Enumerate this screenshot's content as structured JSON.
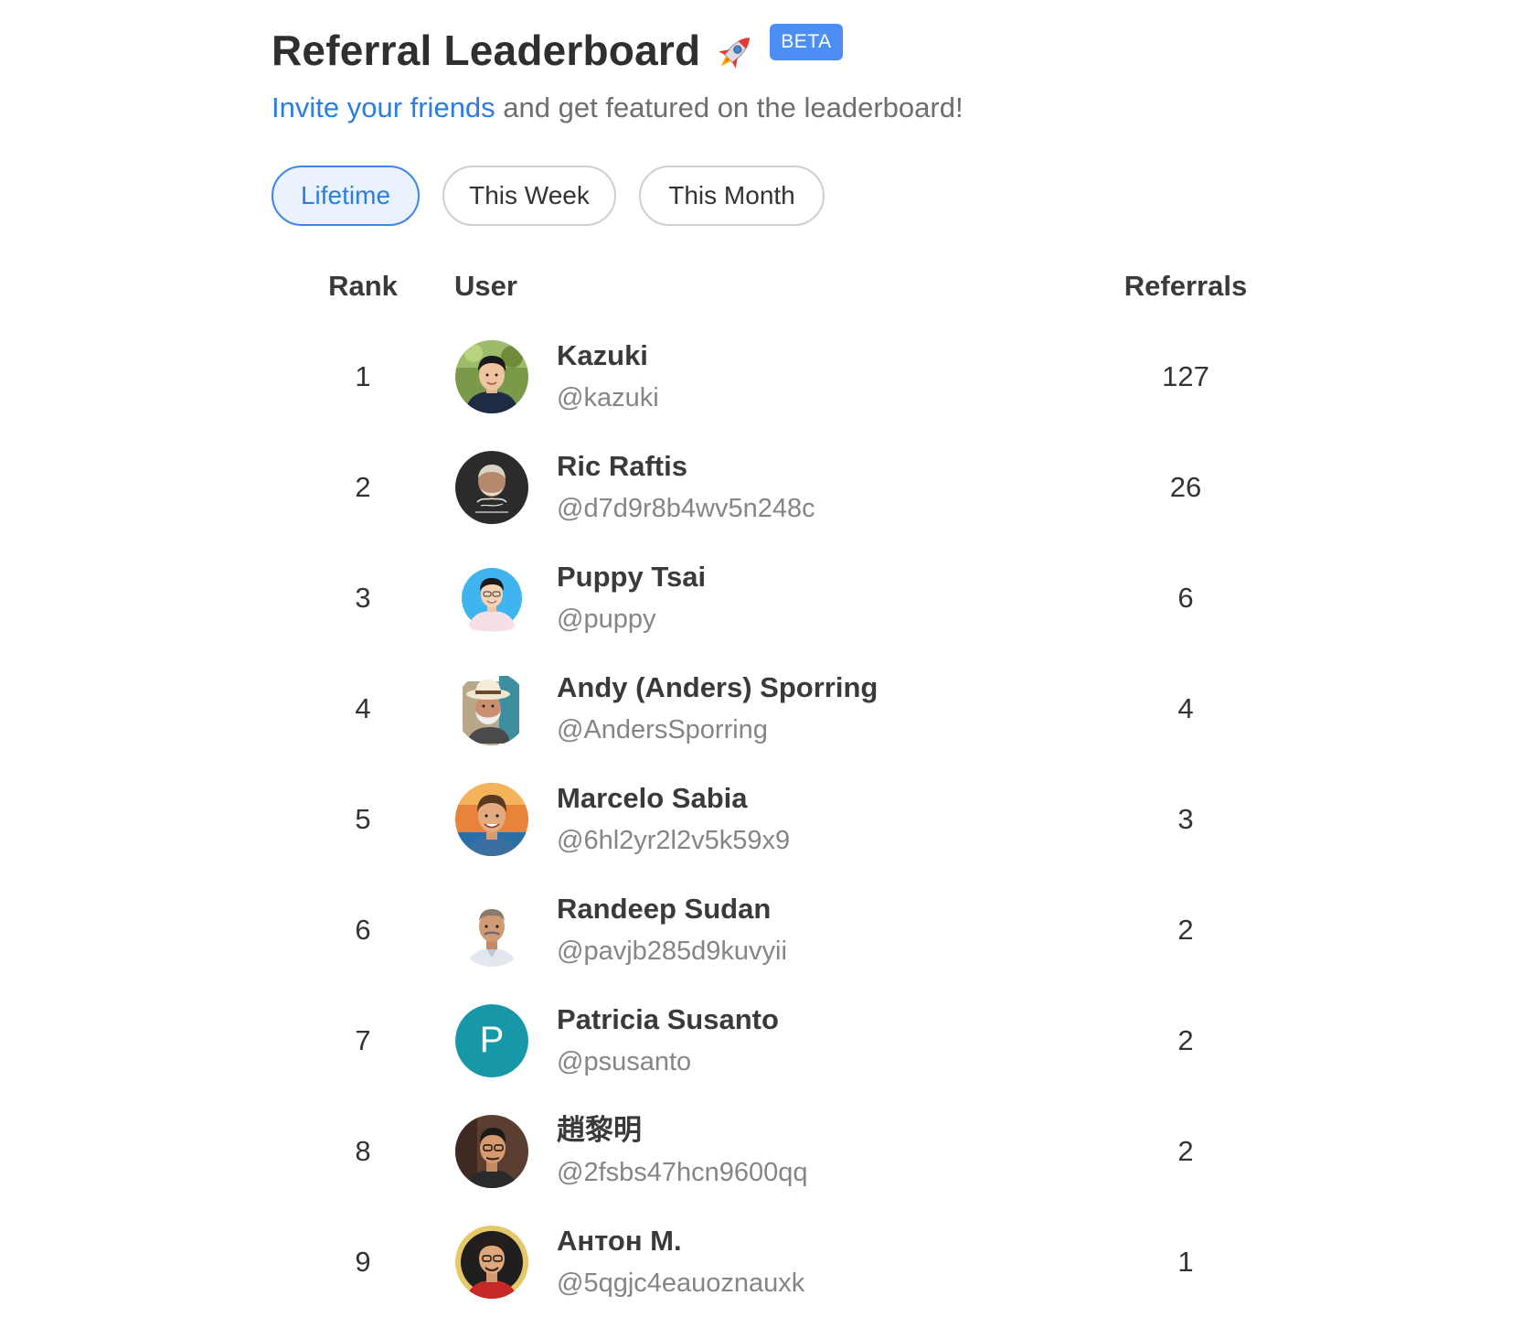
{
  "header": {
    "title": "Referral Leaderboard",
    "title_icon": "rocket-icon",
    "badge": "BETA",
    "subtitle_link": "Invite your friends",
    "subtitle_rest": " and get featured on the leaderboard!",
    "accent_color": "#2a7de1",
    "badge_color": "#4d8ef5"
  },
  "tabs": [
    {
      "label": "Lifetime",
      "active": true
    },
    {
      "label": "This Week",
      "active": false
    },
    {
      "label": "This Month",
      "active": false
    }
  ],
  "table": {
    "columns": {
      "rank": "Rank",
      "user": "User",
      "referrals": "Referrals"
    },
    "rows": [
      {
        "rank": "1",
        "name": "Kazuki",
        "handle": "@kazuki",
        "referrals": "127",
        "avatar": "photo-avatar"
      },
      {
        "rank": "2",
        "name": "Ric Raftis",
        "handle": "@d7d9r8b4wv5n248c",
        "referrals": "26",
        "avatar": "photo-avatar"
      },
      {
        "rank": "3",
        "name": "Puppy Tsai",
        "handle": "@puppy",
        "referrals": "6",
        "avatar": "photo-avatar"
      },
      {
        "rank": "4",
        "name": "Andy (Anders) Sporring",
        "handle": "@AndersSporring",
        "referrals": "4",
        "avatar": "photo-avatar"
      },
      {
        "rank": "5",
        "name": "Marcelo Sabia",
        "handle": "@6hl2yr2l2v5k59x9",
        "referrals": "3",
        "avatar": "photo-avatar"
      },
      {
        "rank": "6",
        "name": "Randeep Sudan",
        "handle": "@pavjb285d9kuvyii",
        "referrals": "2",
        "avatar": "photo-avatar"
      },
      {
        "rank": "7",
        "name": "Patricia Susanto",
        "handle": "@psusanto",
        "referrals": "2",
        "avatar": "P",
        "avatar_color": "#1798a8"
      },
      {
        "rank": "8",
        "name": "趙黎明",
        "handle": "@2fsbs47hcn9600qq",
        "referrals": "2",
        "avatar": "photo-avatar"
      },
      {
        "rank": "9",
        "name": "Антон М.",
        "handle": "@5qgjc4eauoznauxk",
        "referrals": "1",
        "avatar": "photo-avatar"
      }
    ]
  }
}
